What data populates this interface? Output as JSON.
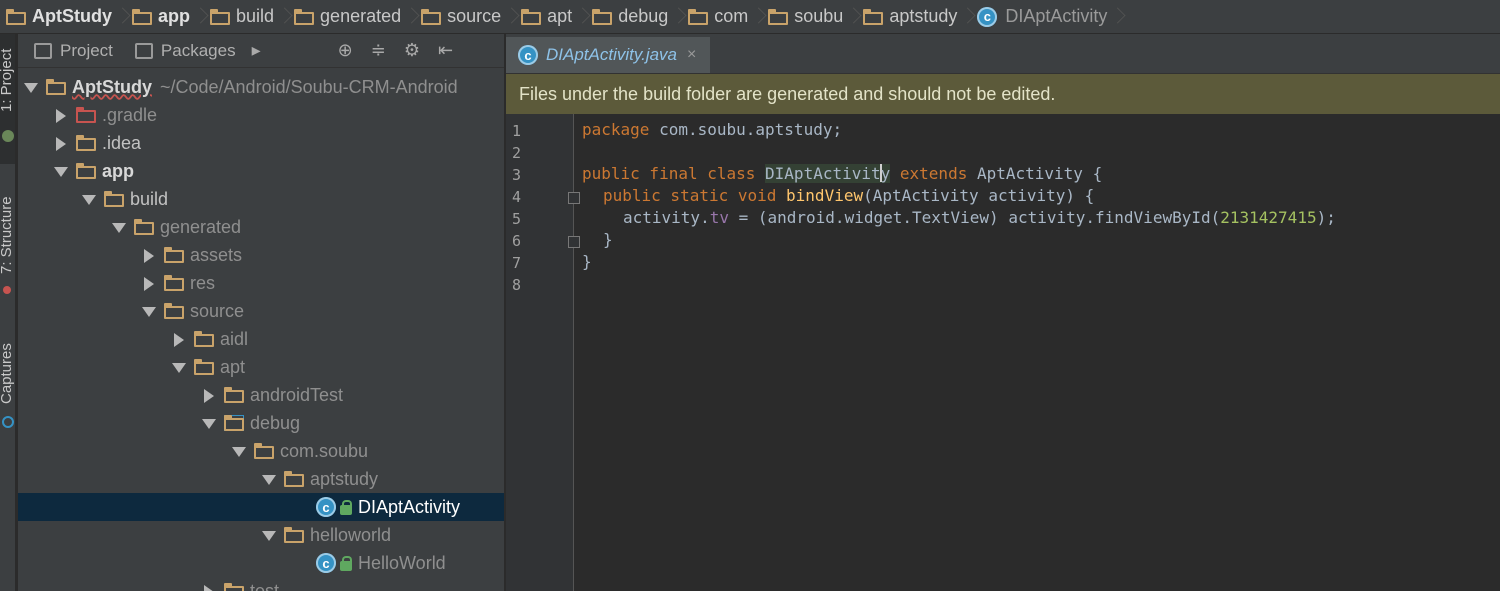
{
  "navbar": {
    "crumbs": [
      "AptStudy",
      "app",
      "build",
      "generated",
      "source",
      "apt",
      "debug",
      "com",
      "soubu",
      "aptstudy",
      "DIAptActivity"
    ]
  },
  "toolstrip": {
    "tabs": [
      "1: Project",
      "7: Structure",
      "Captures"
    ]
  },
  "project_panel": {
    "tabs": [
      "Project",
      "Packages"
    ],
    "tree": [
      {
        "label": "AptStudy",
        "sub": "~/Code/Android/Soubu-CRM-Android"
      },
      {
        "label": ".gradle"
      },
      {
        "label": ".idea"
      },
      {
        "label": "app"
      },
      {
        "label": "build"
      },
      {
        "label": "generated"
      },
      {
        "label": "assets"
      },
      {
        "label": "res"
      },
      {
        "label": "source"
      },
      {
        "label": "aidl"
      },
      {
        "label": "apt"
      },
      {
        "label": "androidTest"
      },
      {
        "label": "debug"
      },
      {
        "label": "com.soubu"
      },
      {
        "label": "aptstudy"
      },
      {
        "label": "DIAptActivity"
      },
      {
        "label": "helloworld"
      },
      {
        "label": "HelloWorld"
      },
      {
        "label": "test"
      }
    ]
  },
  "editor": {
    "tab_label": "DIAptActivity.java",
    "tab_close": "×",
    "banner": "Files under the build folder are generated and should not be edited.",
    "line_numbers": [
      "1",
      "2",
      "3",
      "4",
      "5",
      "6",
      "7",
      "8"
    ],
    "code": {
      "l1_kw": "package",
      "l1_rest": " com.soubu.aptstudy;",
      "l3_kw": "public final class ",
      "l3_cls_a": "DIAptActivit",
      "l3_cls_b": "y",
      "l3_kw2": " extends ",
      "l3_rest": "AptActivity {",
      "l4_kw": "public static void ",
      "l4_fn": "bindView",
      "l4_rest": "(AptActivity activity) {",
      "l5_a": "activity.",
      "l5_fld": "tv",
      "l5_b": " = (android.widget.TextView) activity.findViewById(",
      "l5_num": "2131427415",
      "l5_c": ");",
      "l6": "}",
      "l7": "}"
    }
  }
}
